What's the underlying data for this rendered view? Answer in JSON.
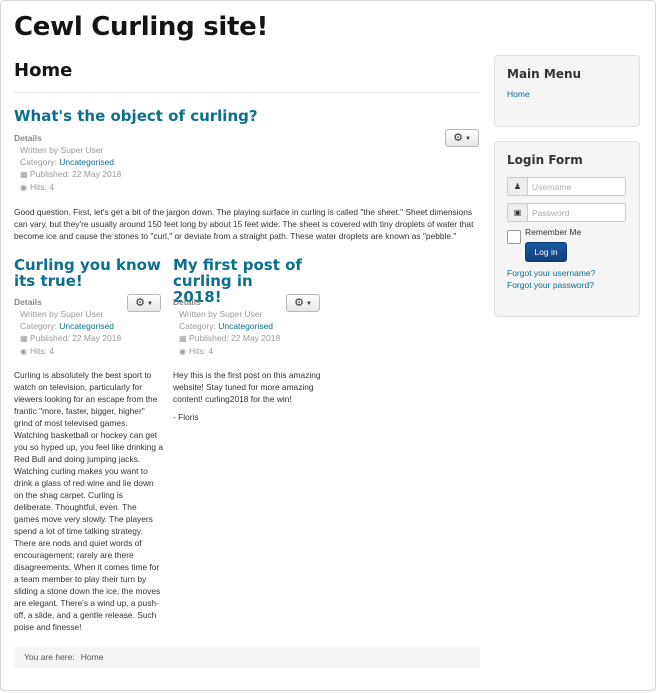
{
  "site": {
    "title": "Cewl Curling site!"
  },
  "page": {
    "heading": "Home"
  },
  "labels": {
    "details": "Details",
    "written_by": "Written by Super User",
    "category_prefix": "Category: ",
    "published": "Published: 22 May 2018",
    "hits": "Hits: 4"
  },
  "articles": [
    {
      "title": "What's the object of curling?",
      "category": "Uncategorised",
      "body": "Good question. First, let's get a bit of the jargon down. The playing surface in curling is called \"the sheet.\" Sheet dimensions can vary, but they're usually around 150 feet long by about 15 feet wide. The sheet is covered with tiny droplets of water that become ice and cause the stones to \"curl,\" or deviate from a straight path. These water droplets are known as \"pebble.\""
    },
    {
      "title": "Curling you know its true!",
      "category": "Uncategorised",
      "body": "Curling is absolutely the best sport to watch on television, particularly for viewers looking for an escape from the frantic \"more, faster, bigger, higher\" grind of most televised games. Watching basketball or hockey can get you so hyped up, you feel like drinking a Red Bull and doing jumping jacks. Watching curling makes you want to drink a glass of red wine and lie down on the shag carpet. Curling is deliberate. Thoughtful, even. The games move very slowly. The players spend a lot of time talking strategy. There are nods and quiet words of encouragement; rarely are there disagreements. When it comes time for a team member to play their turn by sliding a stone down the ice, the moves are elegant. There's a wind up, a push-off, a slide, and a gentle release. Such poise and finesse!"
    },
    {
      "title": "My first post of curling in 2018!",
      "category": "Uncategorised",
      "body": "Hey this is the first post on this amazing website! Stay tuned for more amazing content! curling2018 for the win!",
      "signature": "- Floris"
    }
  ],
  "breadcrumb": {
    "prefix": "You are here:",
    "home": "Home"
  },
  "main_menu": {
    "title": "Main Menu",
    "items": [
      "Home"
    ]
  },
  "login": {
    "title": "Login Form",
    "username_placeholder": "Username",
    "password_placeholder": "Password",
    "remember": "Remember Me",
    "button": "Log in",
    "forgot_username": "Forgot your username?",
    "forgot_password": "Forgot your password?"
  },
  "icons": {
    "user": "user-icon",
    "lock": "lock-icon",
    "gear": "gear-icon",
    "calendar": "calendar-icon",
    "eye": "eye-icon"
  },
  "colors": {
    "link": "#0d6e8e",
    "button": "#0f3f7a"
  }
}
